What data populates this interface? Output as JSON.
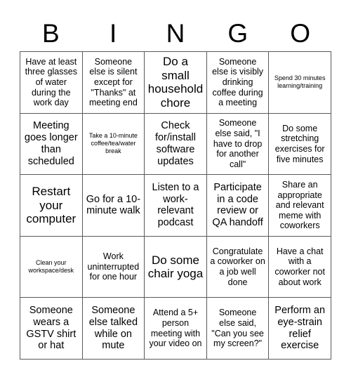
{
  "card": {
    "title": "BINGO",
    "header_letters": [
      "B",
      "I",
      "N",
      "G",
      "O"
    ],
    "rows": [
      [
        {
          "text": "Have at least three glasses of water during the work day",
          "size": "sm"
        },
        {
          "text": "Someone else is silent except for \"Thanks\" at meeting end",
          "size": "sm"
        },
        {
          "text": "Do a small household chore",
          "size": "lg"
        },
        {
          "text": "Someone else is visibly drinking coffee during a meeting",
          "size": "sm"
        },
        {
          "text": "Spend 30 minutes learning/training",
          "size": "xs"
        }
      ],
      [
        {
          "text": "Meeting goes longer than scheduled",
          "size": "md"
        },
        {
          "text": "Take a 10-minute coffee/tea/water break",
          "size": "xs"
        },
        {
          "text": "Check for/install software updates",
          "size": "md"
        },
        {
          "text": "Someone else said, \"I have to drop for another call\"",
          "size": "sm"
        },
        {
          "text": "Do some stretching exercises for five minutes",
          "size": "sm"
        }
      ],
      [
        {
          "text": "Restart your computer",
          "size": "lg"
        },
        {
          "text": "Go for a 10-minute walk",
          "size": "md"
        },
        {
          "text": "Listen to a work-relevant podcast",
          "size": "md"
        },
        {
          "text": "Participate in a code review or QA handoff",
          "size": "md"
        },
        {
          "text": "Share an appropriate and relevant meme with coworkers",
          "size": "sm"
        }
      ],
      [
        {
          "text": "Clean your workspace/desk",
          "size": "xs"
        },
        {
          "text": "Work uninterrupted for one hour",
          "size": "sm"
        },
        {
          "text": "Do some chair yoga",
          "size": "lg"
        },
        {
          "text": "Congratulate a coworker on a job well done",
          "size": "sm"
        },
        {
          "text": "Have a chat with a coworker not about work",
          "size": "sm"
        }
      ],
      [
        {
          "text": "Someone wears a GSTV shirt or hat",
          "size": "md"
        },
        {
          "text": "Someone else talked while on mute",
          "size": "md"
        },
        {
          "text": "Attend a 5+ person meeting with your video on",
          "size": "sm"
        },
        {
          "text": "Someone else said, \"Can you see my screen?\"",
          "size": "sm"
        },
        {
          "text": "Perform an eye-strain relief exercise",
          "size": "md"
        }
      ]
    ]
  },
  "colors": {
    "background": "#ffffff",
    "text": "#000000",
    "border": "#555a5e"
  }
}
